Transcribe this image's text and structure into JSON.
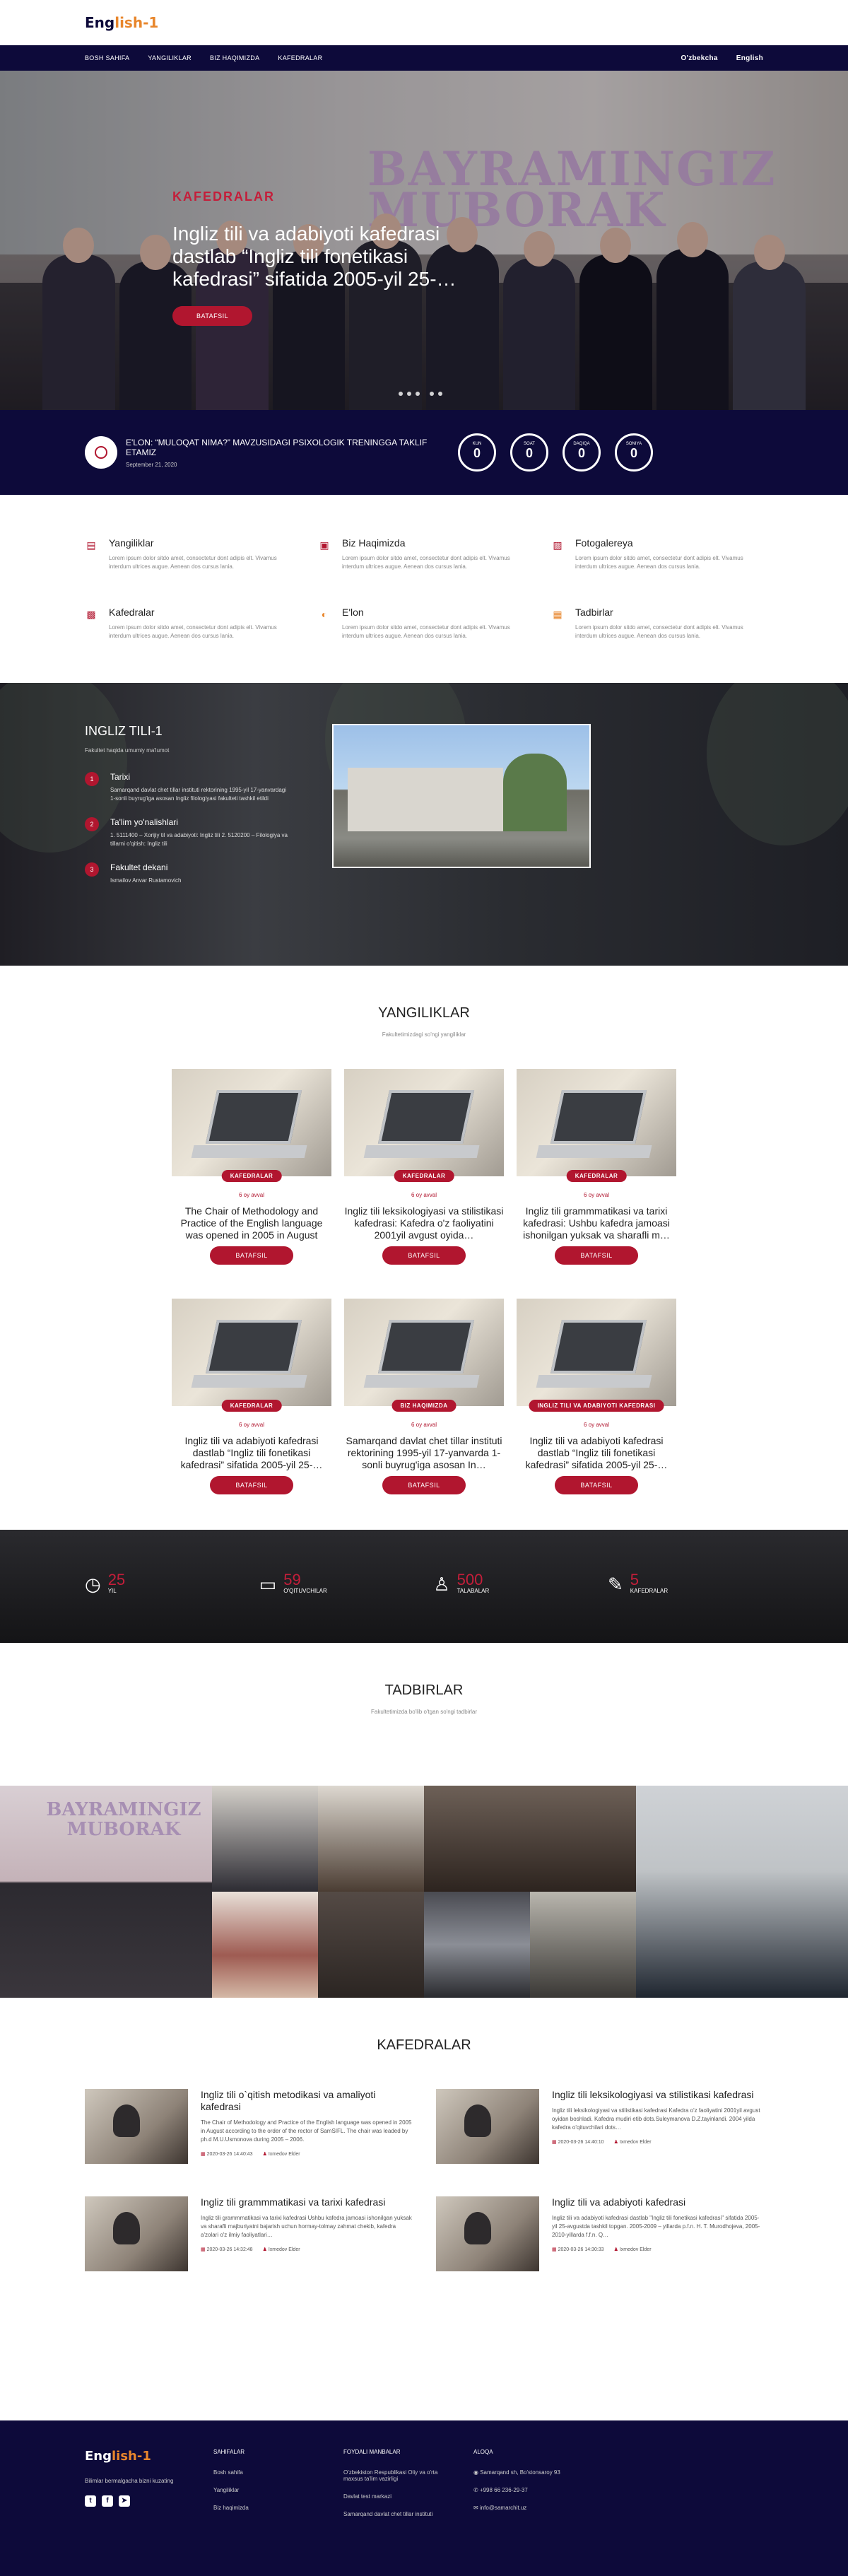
{
  "brand": {
    "logo_main": "Eng",
    "logo_accent": "lish-1"
  },
  "nav": {
    "left": [
      "BOSH SAHIFA",
      "YANGILIKLAR",
      "BIZ HAQIMIZDA",
      "KAFEDRALAR"
    ],
    "right": [
      "O'zbekcha",
      "English"
    ]
  },
  "hero": {
    "kicker": "KAFEDRALAR",
    "title": "Ingliz tili va adabiyoti kafedrasi dastlab “Ingliz tili fonetikasi kafedrasi” sifatida 2005-yil 25-…",
    "button": "BATAFSIL"
  },
  "announcement": {
    "title": "E'LON: “MULOQAT NIMA?” MAVZUSIDAGI PSIXOLOGIK TRENINGGA TAKLIF ETAMIZ",
    "date": "September 21, 2020",
    "countdown": [
      {
        "label": "KUN",
        "value": "0"
      },
      {
        "label": "SOAT",
        "value": "0"
      },
      {
        "label": "DAQIQA",
        "value": "0"
      },
      {
        "label": "SONIYA",
        "value": "0"
      }
    ]
  },
  "services": [
    {
      "icon": "newspaper-icon",
      "title": "Yangiliklar",
      "text": "Lorem ipsum dolor sitdo amet, consectetur dont adipis elt. Vivamus interdum ultrices augue. Aenean dos cursus lania."
    },
    {
      "icon": "id-card-icon",
      "title": "Biz Haqimizda",
      "text": "Lorem ipsum dolor sitdo amet, consectetur dont adipis elt. Vivamus interdum ultrices augue. Aenean dos cursus lania."
    },
    {
      "icon": "photo-icon",
      "title": "Fotogalereya",
      "text": "Lorem ipsum dolor sitdo amet, consectetur dont adipis elt. Vivamus interdum ultrices augue. Aenean dos cursus lania."
    },
    {
      "icon": "image-icon",
      "title": "Kafedralar",
      "text": "Lorem ipsum dolor sitdo amet, consectetur dont adipis elt. Vivamus interdum ultrices augue. Aenean dos cursus lania."
    },
    {
      "icon": "megaphone-icon",
      "title": "E'lon",
      "text": "Lorem ipsum dolor sitdo amet, consectetur dont adipis elt. Vivamus interdum ultrices augue. Aenean dos cursus lania."
    },
    {
      "icon": "calendar-icon",
      "title": "Tadbirlar",
      "text": "Lorem ipsum dolor sitdo amet, consectetur dont adipis elt. Vivamus interdum ultrices augue. Aenean dos cursus lania."
    }
  ],
  "about": {
    "title": "INGLIZ TILI-1",
    "subtitle": "Fakultet haqida umumiy ma'lumot",
    "steps": [
      {
        "num": "1",
        "title": "Tarixi",
        "text": "Samarqand davlat chet tillar instituti rektorining 1995-yil 17-yanvardagi 1-sonli buyrug'iga asosan Ingliz filologiyasi fakulteti tashkil etildi"
      },
      {
        "num": "2",
        "title": "Ta'lim yo'nalishlari",
        "text": "1. 5111400 – Xorijiy til va adabiyoti: Ingliz tili 2. 5120200 – Filologiya va tillarni o'qitish: Ingliz tili"
      },
      {
        "num": "3",
        "title": "Fakultet dekani",
        "text": "Ismailov Anvar Rustamovich"
      }
    ]
  },
  "news": {
    "title": "YANGILIKLAR",
    "subtitle": "Fakultetimizdagi so'ngi yangiliklar",
    "button": "BATAFSIL",
    "items": [
      {
        "tag": "KAFEDRALAR",
        "meta": "6 oy avval",
        "title": "The Chair of Methodology and Practice of the English language was opened in 2005 in August according…"
      },
      {
        "tag": "KAFEDRALAR",
        "meta": "6 oy avval",
        "title": "Ingliz tili leksikologiyasi va stilistikasi kafedrasi: Kafedra o'z faoliyatini 2001yil avgust oyida…"
      },
      {
        "tag": "KAFEDRALAR",
        "meta": "6 oy avval",
        "title": "Ingliz tili grammmatikasi va tarixi kafedrasi: Ushbu kafedra jamoasi ishonilgan yuksak va sharafli m…"
      },
      {
        "tag": "KAFEDRALAR",
        "meta": "6 oy avval",
        "title": "Ingliz tili va adabiyoti kafedrasi dastlab “Ingliz tili fonetikasi kafedrasi” sifatida 2005-yil 25-…"
      },
      {
        "tag": "BIZ HAQIMIZDA",
        "meta": "6 oy avval",
        "title": "Samarqand davlat chet tillar instituti rektorining 1995-yil 17-yanvarda 1-sonli buyrug'iga asosan In…"
      },
      {
        "tag": "INGLIZ TILI VA ADABIYOTI KAFEDRASI",
        "meta": "6 oy avval",
        "title": "Ingliz tili va adabiyoti kafedrasi dastlab “Ingliz tili fonetikasi kafedrasi” sifatida 2005-yil 25-…"
      }
    ]
  },
  "stats": [
    {
      "icon": "clock-icon",
      "num": "25",
      "label": "YIL"
    },
    {
      "icon": "briefcase-icon",
      "num": "59",
      "label": "O'QITUVCHILAR"
    },
    {
      "icon": "user-icon",
      "num": "500",
      "label": "TALABALAR"
    },
    {
      "icon": "pencil-icon",
      "num": "5",
      "label": "KAFEDRALAR"
    }
  ],
  "events": {
    "title": "TADBIRLAR",
    "subtitle": "Fakultetimizda bo'lib o'tgan so'ngi tadbirlar",
    "banner_text": "BAYRAMINGIZ MUBORAK"
  },
  "kafedralar": {
    "title": "KAFEDRALAR",
    "items": [
      {
        "title": "Ingliz tili o`qitish metodikasi va amaliyoti kafedrasi",
        "text": "The Chair of Methodology and Practice of the English language was opened in 2005 in August according to the order of the rector of SamSIFL. The chair was leaded by ph.d M.U.Usmonova during 2005 – 2006.",
        "date": "2020-03-26 14:40:43",
        "author": "Ixmedov Elder"
      },
      {
        "title": "Ingliz tili leksikologiyasi va stilistikasi kafedrasi",
        "text": "Ingliz tili leksikologiyasi va stilistikasi kafedrasi Kafedra o'z faoliyatini 2001yil avgust oyidan boshladi. Kafedra mudiri etib dots.Suleymanova D.Z.tayinlandi. 2004 yilda kafedra o'qituvchilari dots…",
        "date": "2020-03-26 14:40:10",
        "author": "Ixmedov Elder"
      },
      {
        "title": "Ingliz tili grammmatikasi va tarixi kafedrasi",
        "text": "Ingliz tili grammmatikasi va tarixi kafedrasi Ushbu kafedra jamoasi ishonilgan yuksak va sharafli majburiyatni bajarish uchun hormay-tolmay zahmat chekib, kafedra a'zolari o'z ilmiy faoliyatlari…",
        "date": "2020-03-26 14:32:48",
        "author": "Ixmedov Elder"
      },
      {
        "title": "Ingliz tili va adabiyoti kafedrasi",
        "text": "Ingliz tili va adabiyoti kafedrasi dastlab \"Ingliz tili fonetikasi kafedrasi\" sifatida 2005-yil 25-avgustda tashkil topgan. 2005-2009 – yillarda p.f.n. H. T. Murodhojeva, 2005-2010-yillarda f.f.n. Q…",
        "date": "2020-03-26 14:30:33",
        "author": "Ixmedov Elder"
      }
    ]
  },
  "footer": {
    "logo_main": "Eng",
    "logo_accent": "lish-1",
    "tagline": "Bilimlar bermalgacha bizni kuzating",
    "col1": {
      "title": "SAHIFALAR",
      "links": [
        "Bosh sahifa",
        "Yangiliklar",
        "Biz haqimizda"
      ]
    },
    "col2": {
      "title": "FOYDALI MANBALAR",
      "links": [
        "O'zbekiston Respublikasi Oliy va o'rta maxsus ta'lim vazirligi",
        "Davlat test markazi",
        "Samarqand davlat chet tillar instituti"
      ]
    },
    "col3": {
      "title": "ALOQA",
      "links": [
        "Samarqand sh, Bo'stonsaroy 93",
        "+998 66 236-29-37",
        "info@samarchit.uz"
      ]
    }
  }
}
